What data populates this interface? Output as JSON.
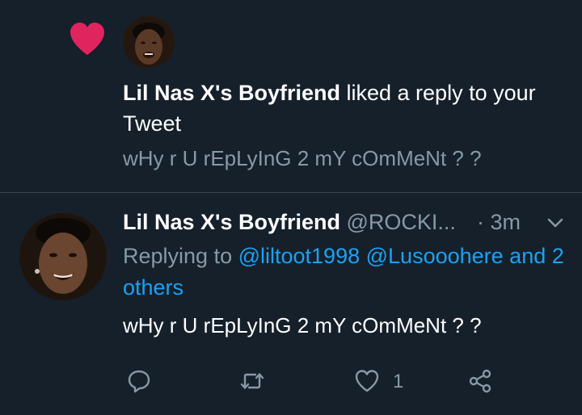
{
  "notification": {
    "user_name": "Lil Nas X's Boyfriend",
    "action_text": " liked a reply to your Tweet",
    "preview_text": "wHy r U rEpLyInG 2 mY cOmMeNt ? ?",
    "icon": "heart-icon",
    "icon_color": "#e0245e"
  },
  "tweet": {
    "user_name": "Lil Nas X's Boyfriend",
    "handle": "@ROCKI...",
    "time": "· 3m",
    "replying_prefix": "Replying to ",
    "mention_1": "@liltoot1998",
    "mention_2": "@Lusooohere",
    "others": "and 2 others",
    "body": "wHy r U rEpLyInG 2 mY cOmMeNt ? ?",
    "like_count": "1",
    "actions": [
      "reply-icon",
      "retweet-icon",
      "like-icon",
      "share-icon"
    ]
  },
  "colors": {
    "background": "#15202b",
    "secondary_text": "#8899a6",
    "link": "#1da1f2",
    "divider": "#38444d"
  }
}
